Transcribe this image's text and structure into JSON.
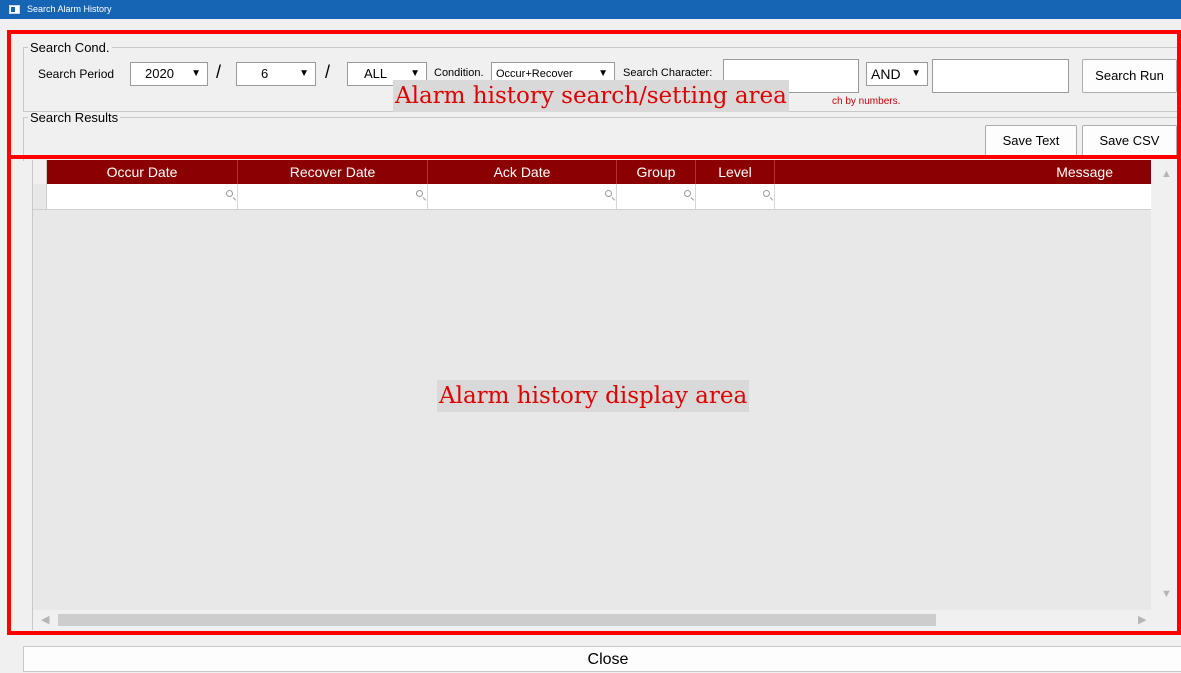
{
  "window": {
    "title": "Search Alarm History"
  },
  "search_cond": {
    "legend": "Search Cond.",
    "period_label": "Search Period",
    "year": "2020",
    "month": "6",
    "day": "ALL",
    "separator": "/",
    "condition_label": "Condition.",
    "condition_value": "Occur+Recover",
    "search_char_label": "Search Character:",
    "search_char_value_1": "",
    "logic_operator": "AND",
    "search_char_value_2": "",
    "run_button": "Search Run",
    "hint_text": "ch by numbers."
  },
  "search_results": {
    "legend": "Search Results",
    "save_text_button": "Save Text",
    "save_csv_button": "Save CSV"
  },
  "grid": {
    "columns": [
      "Occur Date",
      "Recover Date",
      "Ack Date",
      "Group",
      "Level",
      "Message"
    ],
    "rows": []
  },
  "annotations": {
    "search_area": "Alarm history search/setting area",
    "display_area": "Alarm history display area"
  },
  "footer": {
    "close_button": "Close"
  },
  "colors": {
    "header_bg": "#8b0000",
    "annotation_box": "#ff0000",
    "titlebar": "#1565b4"
  },
  "icons": {
    "filter": "magnifier-icon",
    "scroll_up": "arrow-up-icon",
    "scroll_down": "arrow-down-icon",
    "scroll_left": "arrow-left-icon",
    "scroll_right": "arrow-right-icon",
    "dropdown": "chevron-down-icon"
  }
}
